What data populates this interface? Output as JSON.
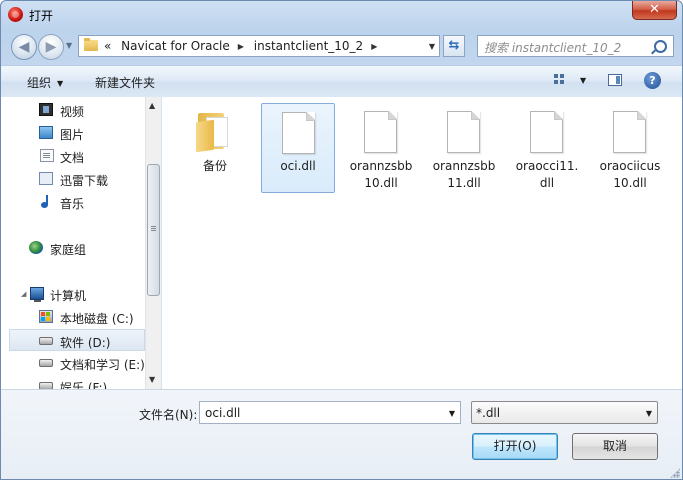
{
  "window": {
    "title": "打开",
    "close_label": "✕"
  },
  "address_bar": {
    "prefix": "«",
    "crumbs": [
      "Navicat for Oracle",
      "instantclient_10_2"
    ]
  },
  "search": {
    "placeholder": "搜索 instantclient_10_2"
  },
  "toolbar": {
    "organize_label": "组织",
    "new_folder_label": "新建文件夹",
    "help_label": "?"
  },
  "nav_pane": {
    "items": [
      {
        "label": "视频",
        "icon": "video-icon"
      },
      {
        "label": "图片",
        "icon": "pictures-icon"
      },
      {
        "label": "文档",
        "icon": "documents-icon"
      },
      {
        "label": "迅雷下载",
        "icon": "download-icon"
      },
      {
        "label": "音乐",
        "icon": "music-icon"
      },
      {
        "label": "家庭组",
        "icon": "homegroup-icon"
      },
      {
        "label": "计算机",
        "icon": "computer-icon"
      },
      {
        "label": "本地磁盘 (C:)",
        "icon": "drive-c-icon"
      },
      {
        "label": "软件 (D:)",
        "icon": "drive-icon",
        "selected": true
      },
      {
        "label": "文档和学习 (E:)",
        "icon": "drive-icon"
      },
      {
        "label": "娱乐 (F:)",
        "icon": "drive-icon"
      }
    ]
  },
  "files": [
    {
      "name": "备份",
      "type": "folder"
    },
    {
      "name": "oci.dll",
      "type": "file",
      "selected": true
    },
    {
      "name": "orannzsbb\n10.dll",
      "type": "file"
    },
    {
      "name": "orannzsbb\n11.dll",
      "type": "file"
    },
    {
      "name": "oraocci11.\ndll",
      "type": "file"
    },
    {
      "name": "oraociicus\n10.dll",
      "type": "file"
    }
  ],
  "footer": {
    "filename_label": "文件名(N):",
    "filename_value": "oci.dll",
    "filetype_value": "*.dll",
    "open_label": "打开(O)",
    "cancel_label": "取消"
  },
  "colors": {
    "accent": "#84acdd",
    "close_button": "#c0381f"
  }
}
